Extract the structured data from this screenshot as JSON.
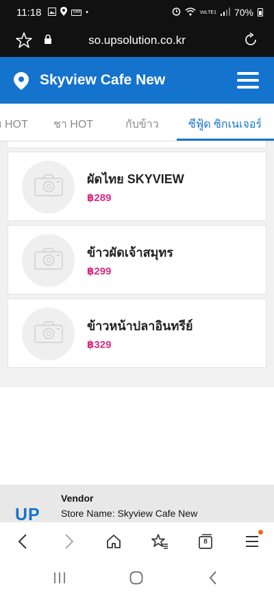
{
  "status_bar": {
    "time": "11:18",
    "sim_label": "SIM",
    "network": "VoLTE1",
    "battery": "70%"
  },
  "browser": {
    "url": "so.upsolution.co.kr",
    "tab_count": "8"
  },
  "header": {
    "title": "Skyview Cafe New"
  },
  "tabs": [
    {
      "label": "ม HOT"
    },
    {
      "label": "ชา HOT"
    },
    {
      "label": "กับข้าว"
    },
    {
      "label": "ซีฟู้ด ซิกเนเจอร์",
      "active": true
    }
  ],
  "items": [
    {
      "name": "ผัดไทย SKYVIEW",
      "price": "฿289"
    },
    {
      "name": "ข้าวผัดเจ้าสมุทร",
      "price": "฿299"
    },
    {
      "name": "ข้าวหน้าปลาอินทรีย์",
      "price": "฿329"
    }
  ],
  "vendor": {
    "logo": "UP",
    "title": "Vendor",
    "store": "Store Name: Skyview Cafe New"
  },
  "colors": {
    "brand_blue": "#1473cc",
    "price_pink": "#d62b83",
    "status_black": "#111111"
  }
}
